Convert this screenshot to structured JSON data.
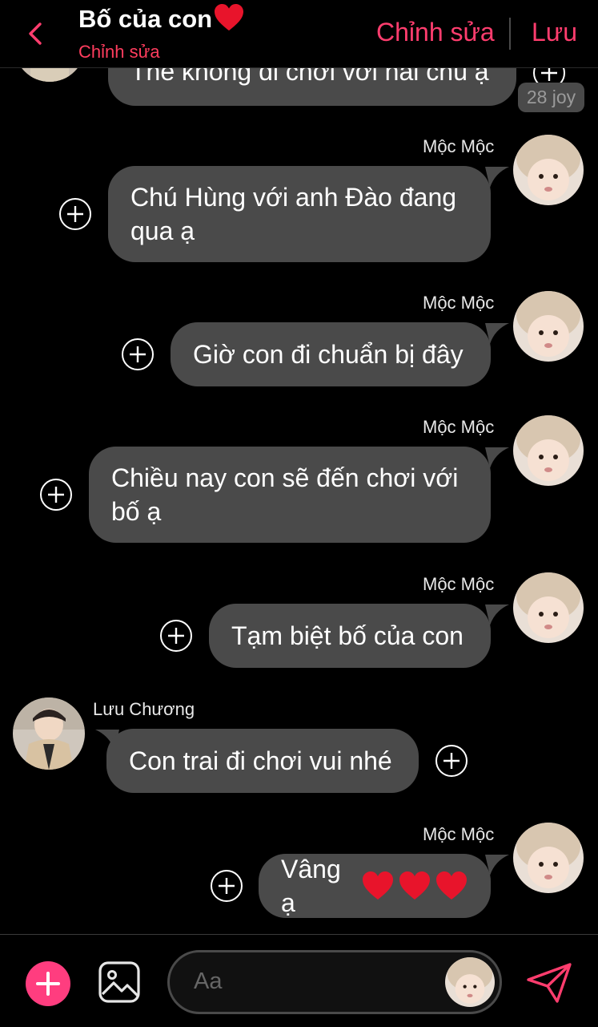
{
  "header": {
    "title": "Bố của con",
    "subtitle": "Chỉnh sửa",
    "edit_label": "Chỉnh sửa",
    "save_label": "Lưu"
  },
  "chat": {
    "top_partial_message": "Thế không đi chơi với hai chú ạ",
    "reaction_badge": "28 joy",
    "messages": [
      {
        "sender": "Mộc Mộc",
        "text": "Chú Hùng với anh Đào đang\nqua ạ"
      },
      {
        "sender": "Mộc Mộc",
        "text": "Giờ con đi chuẩn bị đây"
      },
      {
        "sender": "Mộc Mộc",
        "text": "Chiều nay con sẽ đến chơi với\nbố ạ"
      },
      {
        "sender": "Mộc Mộc",
        "text": "Tạm biệt bố của con"
      },
      {
        "sender": "Lưu Chương",
        "text": "Con trai đi chơi vui nhé"
      },
      {
        "sender": "Mộc Mộc",
        "text": "Vâng ạ"
      }
    ]
  },
  "composer": {
    "placeholder": "Aa"
  },
  "colors": {
    "accent": "#ff3d6e",
    "bubble": "#4a4a4a",
    "background": "#000000",
    "heart": "#e8142b"
  },
  "icons": [
    "back-chevron-icon",
    "heart-icon",
    "add-reaction-icon",
    "plus-icon",
    "image-icon",
    "send-icon"
  ]
}
